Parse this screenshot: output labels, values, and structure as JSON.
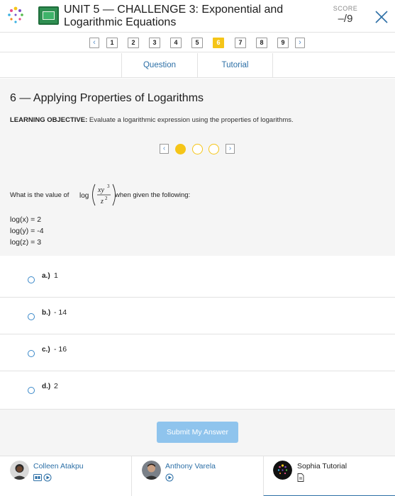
{
  "header": {
    "title_line1": "UNIT 5 — CHALLENGE 3: Exponential and",
    "title_line2": "Logarithmic Equations",
    "score_label": "SCORE",
    "score_value": "–/9"
  },
  "pagenav": {
    "pages": [
      "1",
      "2",
      "3",
      "4",
      "5",
      "6",
      "7",
      "8",
      "9"
    ],
    "current": "6"
  },
  "tabs": [
    "Question",
    "Tutorial"
  ],
  "content": {
    "heading": "6 — Applying Properties of Logarithms",
    "objective_label": "LEARNING OBJECTIVE:",
    "objective_text": "Evaluate a logarithmic expression using the properties of logarithms.",
    "question_prefix": "What is the value of",
    "question_suffix": "when given the following:",
    "expression": {
      "func": "log",
      "numerator_base": "xy",
      "numerator_exp": "3",
      "denominator_base": "z",
      "denominator_exp": "2"
    },
    "givens": [
      "log(x) = 2",
      "log(y) = -4",
      "log(z) = 3"
    ]
  },
  "answers": [
    {
      "letter": "a.)",
      "value": "1"
    },
    {
      "letter": "b.)",
      "value": "- 14"
    },
    {
      "letter": "c.)",
      "value": "- 16"
    },
    {
      "letter": "d.)",
      "value": "2"
    }
  ],
  "submit_label": "Submit My Answer",
  "tutors": [
    {
      "name": "Colleen Atakpu"
    },
    {
      "name": "Anthony Varela"
    },
    {
      "name": "Sophia Tutorial"
    }
  ],
  "colors": {
    "accent": "#f5c518",
    "link": "#2c6fa6",
    "radio": "#3a88c9",
    "submit": "#8fc4ed"
  }
}
